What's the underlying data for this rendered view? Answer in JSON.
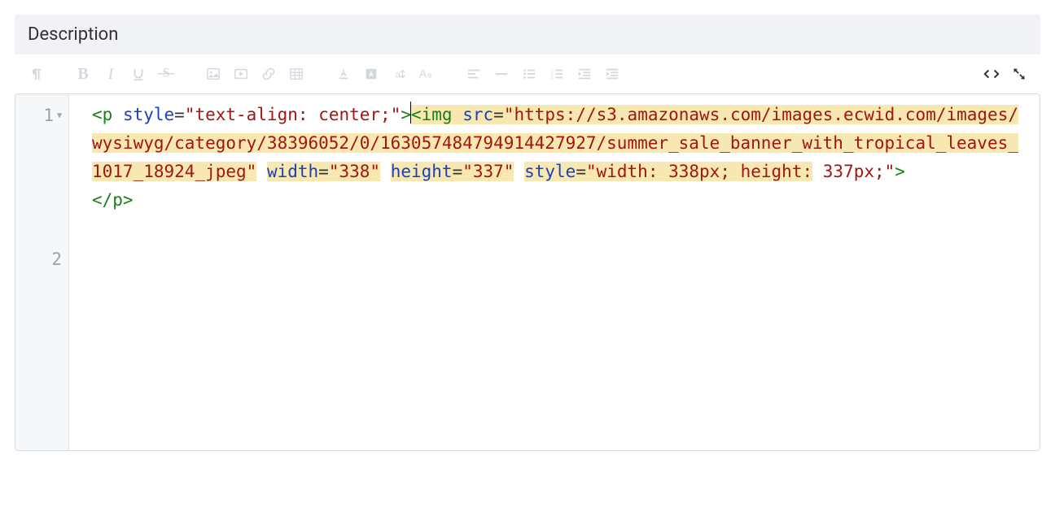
{
  "header": {
    "title": "Description"
  },
  "code": {
    "gutter": [
      "1",
      "2"
    ],
    "line1": {
      "tag_open": "<p",
      "sp": " ",
      "attr_style": "style",
      "eq": "=",
      "style_val": "\"text-align: center;\"",
      "gt": ">",
      "img_open": "<img",
      "src_attr": "src",
      "src_val": "\"https://s3.amazonaws.com/images.ecwid.com/images/wysiwyg/category/38396052/0/16305748479491442792?/summer_sale_banner_with_tropical_leaves_1017_18924_jpeg\"",
      "src_val_display": "\"https://s3.amazonaws.com/images.ecwid.com/images/wysiwyg/category/38396052/0/163057484794914427927/summer_sale_banner_with_tropical_leaves_1017_18924_jpeg\"",
      "width_attr": "width",
      "width_val": "\"338\"",
      "height_attr": "height",
      "height_val": "\"337\"",
      "style2_attr": "style",
      "style2_val_a": "\"width: 338px; height:",
      "style2_val_b": "337px;\"",
      "close": ">"
    },
    "line2": {
      "content": "</p>"
    }
  }
}
